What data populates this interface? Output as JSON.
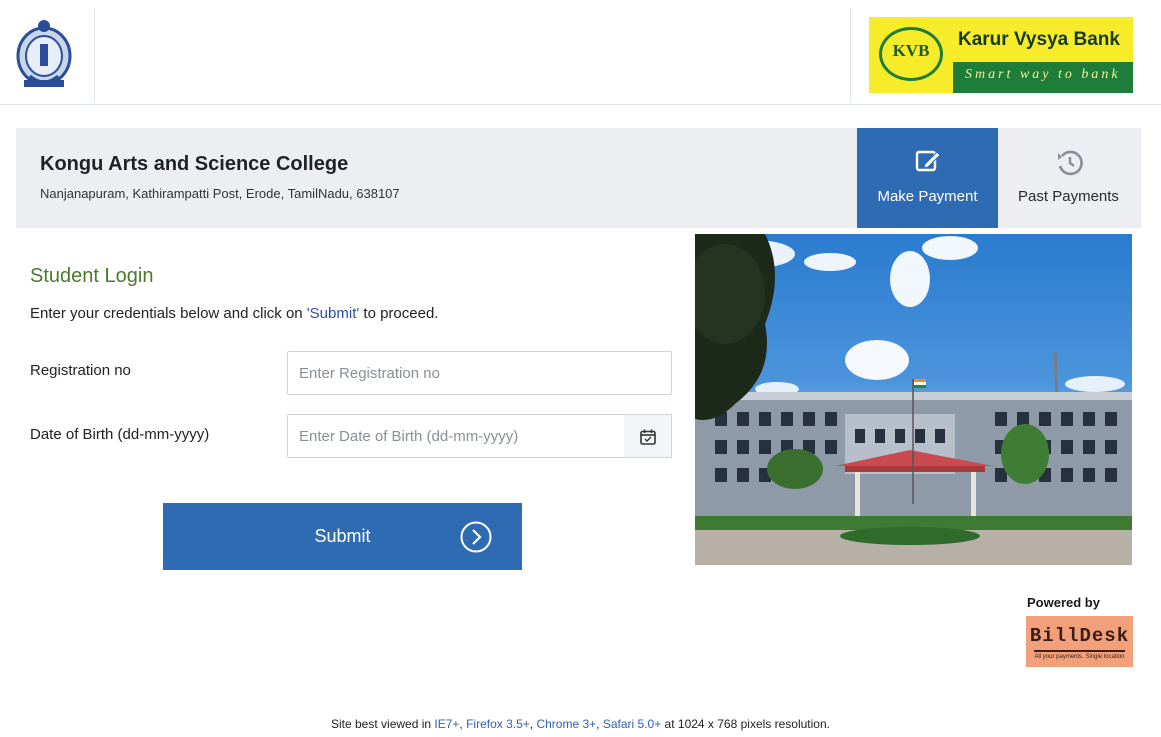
{
  "header": {
    "bank_logo": {
      "abbr": "KVB",
      "name": "Karur Vysya Bank",
      "tagline": "Smart way to bank"
    }
  },
  "college": {
    "name": "Kongu Arts and Science College",
    "address": "Nanjanapuram, Kathirampatti Post, Erode, TamilNadu, 638107"
  },
  "nav": {
    "make_payment": "Make Payment",
    "past_payments": "Past Payments"
  },
  "login": {
    "title": "Student Login",
    "instruction_before": "Enter your credentials below and click on ",
    "instruction_link": "'Submit'",
    "instruction_after": " to proceed.",
    "registration_label": "Registration no",
    "registration_placeholder": "Enter Registration no",
    "registration_value": "",
    "dob_label": "Date of Birth (dd-mm-yyyy)",
    "dob_placeholder": "Enter Date of Birth (dd-mm-yyyy)",
    "dob_value": "",
    "submit_label": "Submit"
  },
  "powered": {
    "label": "Powered by",
    "brand": "BillDesk",
    "brand_tagline": "All your payments. Single location"
  },
  "footer": {
    "prefix": "Site best viewed in ",
    "browsers": [
      "IE7+",
      "Firefox 3.5+",
      "Chrome 3+",
      "Safari 5.0+"
    ],
    "suffix": " at 1024 x 768 pixels resolution."
  },
  "colors": {
    "primary_blue": "#2f6bb2",
    "login_title_green": "#4b7a2c",
    "kvb_yellow": "#f7ec2a",
    "kvb_green": "#1f7d3a",
    "billdesk_orange": "#f2a07a"
  },
  "icons": {
    "college_emblem": "college-emblem-icon",
    "make_payment": "edit-icon",
    "past_payments": "history-icon",
    "calendar": "calendar-icon",
    "submit_arrow": "arrow-right-circle-icon"
  }
}
